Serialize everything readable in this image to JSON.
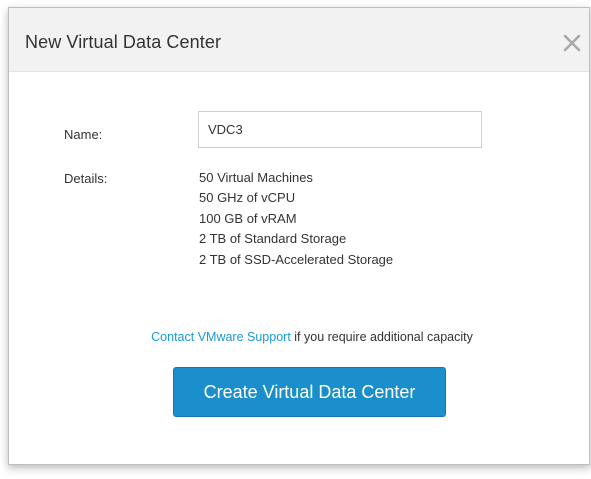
{
  "dialog": {
    "title": "New Virtual Data Center",
    "close_icon": "close-icon"
  },
  "form": {
    "name_label": "Name:",
    "name_value": "VDC3",
    "details_label": "Details:",
    "details": [
      "50 Virtual Machines",
      "50 GHz of vCPU",
      "100 GB of vRAM",
      "2 TB of Standard Storage",
      "2 TB of SSD-Accelerated Storage"
    ]
  },
  "support": {
    "link_text": "Contact VMware Support",
    "suffix_text": " if you require additional capacity"
  },
  "actions": {
    "create_label": "Create Virtual Data Center"
  },
  "colors": {
    "accent": "#1b8fcc",
    "link": "#1a9ad6",
    "header_bg": "#f2f2f2"
  }
}
